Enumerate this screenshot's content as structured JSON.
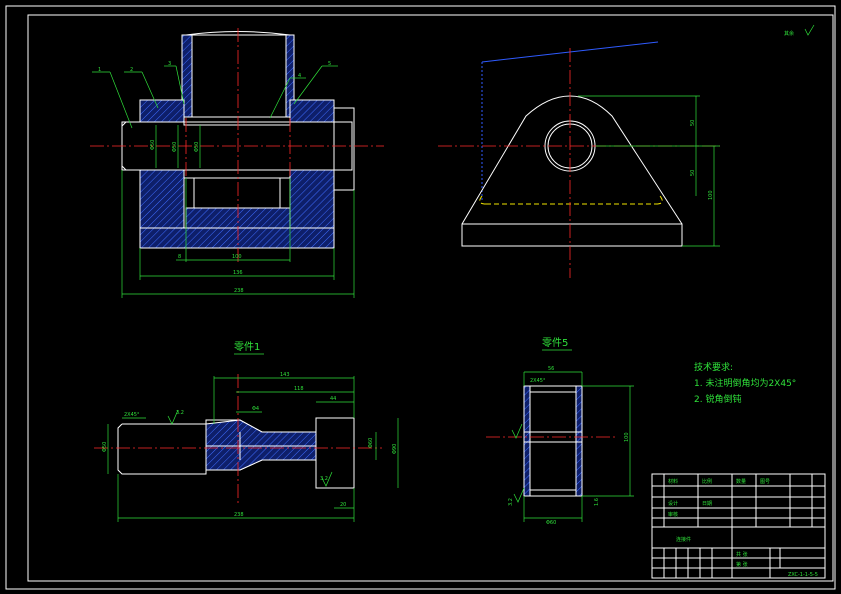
{
  "colors": {
    "background": "#000000",
    "outline": "#ffffff",
    "dimension": "#2fe03a",
    "centerline": "#ff2a2a",
    "hatch": "#2f5bff",
    "hidden_line": "#f0e400"
  },
  "drawing": {
    "surface_mark": "其余",
    "balloons": [
      "1",
      "2",
      "3",
      "4",
      "5"
    ],
    "front_view_dims": {
      "d1": "Φ50",
      "d2": "Φ50",
      "d3": "Φ50",
      "w100": "100",
      "w8": "8",
      "w136": "136",
      "w238": "238"
    },
    "side_view_dims": {
      "v1": "50",
      "v2": "50",
      "v3": "100"
    },
    "part1": {
      "title": "零件1",
      "dims": {
        "l143": "143",
        "l118": "118",
        "l44": "44",
        "l4": "Φ4",
        "chamfer": "2X45°",
        "rough": "3.2",
        "d50": "Φ50",
        "d90": "Φ90",
        "d60": "Φ60",
        "l238": "238",
        "l20": "20",
        "rough2": "3.2"
      }
    },
    "part5": {
      "title": "零件5",
      "dims": {
        "top": "56",
        "chamfer": "2X45°",
        "h": "100",
        "bottom": "Φ60",
        "rough": "3.2",
        "rough2": "1.6"
      }
    },
    "requirements": {
      "title": "技术要求:",
      "items": [
        "1. 未注明倒角均为2X45°",
        "2. 锐角倒钝"
      ]
    },
    "title_block": {
      "drawing_no": "ZXC-1-1-5-5",
      "name": "连接件",
      "cells": [
        "材料",
        "比例",
        "数量",
        "图号",
        "设计",
        "审核",
        "日期",
        "共 张",
        "第 张"
      ]
    }
  }
}
